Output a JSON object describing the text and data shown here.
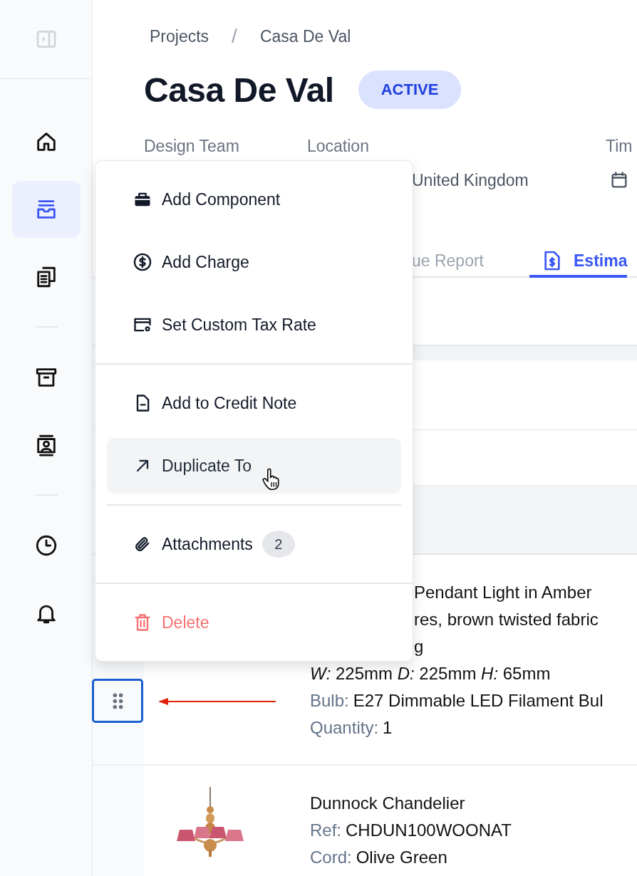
{
  "sidebar": {
    "groups": [
      {
        "items": [
          {
            "selected": false
          },
          {
            "selected": true
          },
          {
            "selected": false
          }
        ]
      },
      {
        "items": [
          {
            "selected": false
          },
          {
            "selected": false
          }
        ]
      },
      {
        "items": [
          {
            "selected": false
          },
          {
            "selected": false
          }
        ]
      }
    ]
  },
  "breadcrumb": [
    {
      "kind": "link",
      "text": "Projects"
    },
    {
      "kind": "separator",
      "text": "/"
    },
    {
      "kind": "link",
      "text": "Casa De Val"
    }
  ],
  "title": "Casa De Val",
  "status": "ACTIVE",
  "meta_labels": [
    "Design Team",
    "Location",
    "Tim"
  ],
  "location": "United Kingdom",
  "tabs": [
    {
      "label": "ue Report",
      "selected": false
    },
    {
      "label": "Estima",
      "selected": true
    }
  ],
  "items": [
    {
      "lines": [
        {
          "kind": "covered",
          "text": "Pendant Light in Amber"
        },
        {
          "kind": "covered",
          "text": "res, brown twisted fabric"
        },
        {
          "kind": "covered",
          "text": "g"
        },
        {
          "kind": "plain",
          "text": "*W:* 225mm *D:* 225mm *H:* 65mm"
        },
        {
          "kind": "field",
          "label": "Bulb:",
          "text": "E27 Dimmable LED Filament Bul"
        },
        {
          "kind": "field",
          "label": "Quantity:",
          "text": "1"
        }
      ]
    },
    {
      "image": {
        "kind": "picture"
      },
      "lines": [
        {
          "kind": "plain",
          "text": "Dunnock Chandelier"
        },
        {
          "kind": "field",
          "label": "Ref:",
          "text": "CHDUN100WOONAT"
        },
        {
          "kind": "field",
          "label": "Cord:",
          "text": "Olive Green"
        }
      ]
    }
  ],
  "menu": {
    "sections": [
      {
        "items": [
          {
            "label": "Add Component",
            "kind": "action",
            "highlighted": false
          },
          {
            "label": "Add Charge",
            "kind": "action",
            "highlighted": false
          },
          {
            "label": "Set Custom Tax Rate",
            "kind": "action",
            "highlighted": false
          }
        ]
      },
      {
        "items": [
          {
            "label": "Add to Credit Note",
            "kind": "action",
            "highlighted": false
          },
          {
            "label": "Duplicate To",
            "kind": "action",
            "highlighted": true
          }
        ]
      },
      {
        "items": [
          {
            "label": "Attachments",
            "kind": "action",
            "highlighted": false,
            "badge": "2"
          }
        ]
      },
      {
        "items": [
          {
            "label": "Delete",
            "kind": "danger",
            "highlighted": false
          }
        ]
      }
    ]
  }
}
